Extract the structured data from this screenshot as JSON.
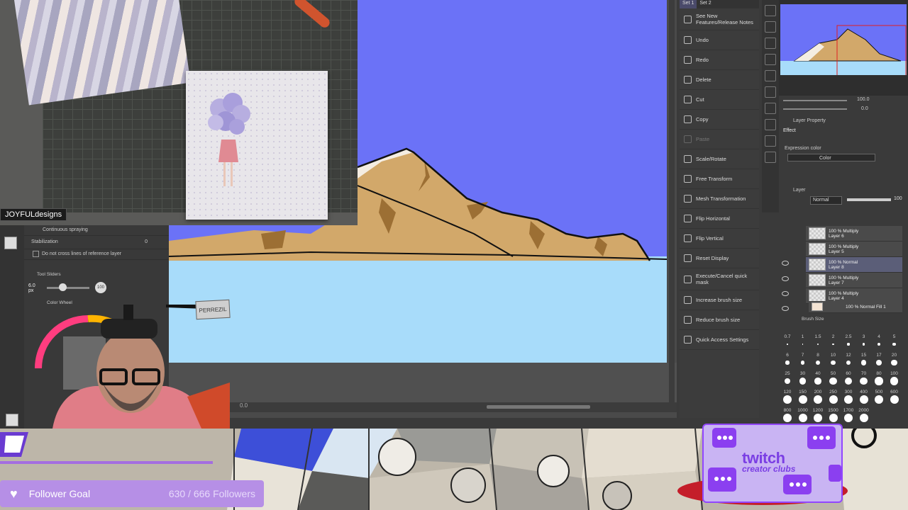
{
  "webcam": {
    "brand_tag": "JOYFULdesigns"
  },
  "tool_property": {
    "rows": [
      "Continuous spraying",
      "Stabilization",
      "Do not cross lines of reference layer"
    ],
    "stabilization_value": "0",
    "tool_sliders_title": "Tool Sliders",
    "brush_size_value": "6.0",
    "brush_size_unit": "px",
    "opacity_value": "100",
    "color_wheel_title": "Color Wheel"
  },
  "command_bar": {
    "set_tabs": [
      "Set 1",
      "Set 2"
    ],
    "items": [
      "See New Features/Release Notes",
      "Undo",
      "Redo",
      "Delete",
      "Cut",
      "Copy",
      "Paste",
      "Scale/Rotate",
      "Free Transform",
      "Mesh Transformation",
      "Flip Horizontal",
      "Flip Vertical",
      "Reset Display",
      "Execute/Cancel quick mask",
      "Increase brush size",
      "Reduce brush size",
      "Quick Access Settings"
    ]
  },
  "navigator": {
    "zoom": "100.0",
    "rotation": "0.0"
  },
  "layer_property": {
    "tab_label": "Layer Property",
    "effect_label": "Effect",
    "expression_color_label": "Expression color",
    "expression_color_value": "Color"
  },
  "layer_panel": {
    "tab_label": "Layer",
    "blend_mode": "Normal",
    "opacity": "100",
    "layers": [
      {
        "mode": "100 % Multiply",
        "name": "Layer 6"
      },
      {
        "mode": "100 % Multiply",
        "name": "Layer 5"
      },
      {
        "mode": "100 % Normal",
        "name": "Layer 8"
      },
      {
        "mode": "100 % Multiply",
        "name": "Layer 7"
      },
      {
        "mode": "100 % Multiply",
        "name": "Layer 4"
      },
      {
        "mode": "100 % Normal",
        "name": "Fill 1"
      }
    ]
  },
  "brush_size_panel": {
    "title": "Brush Size",
    "row1": [
      "0.7",
      "1",
      "1.5",
      "2",
      "2.5",
      "3",
      "4",
      "5"
    ],
    "row2": [
      "6",
      "7",
      "8",
      "10",
      "12",
      "15",
      "17",
      "20"
    ],
    "row3": [
      "25",
      "30",
      "40",
      "50",
      "60",
      "70",
      "80",
      "100"
    ],
    "row4": [
      "120",
      "150",
      "200",
      "250",
      "300",
      "400",
      "500",
      "600"
    ],
    "row5": [
      "800",
      "1000",
      "1200",
      "1500",
      "1700",
      "2000"
    ]
  },
  "canvas_status": {
    "zoom": "0.0"
  },
  "sticker_text": "PERREZIL",
  "follower_goal": {
    "label": "Follower Goal",
    "count": "630 / 666 Followers",
    "current": 630,
    "target": 666
  },
  "twitch": {
    "title": "twitch",
    "subtitle": "creator clubs"
  },
  "colors": {
    "sky": "#6b72f7",
    "water": "#a8dcfa",
    "mountain": "#d2a86a",
    "mountain_shadow": "#9c6f34",
    "snow": "#f4ede2",
    "goal_bar": "#b68fe6",
    "twitch_purple": "#9146ff"
  }
}
